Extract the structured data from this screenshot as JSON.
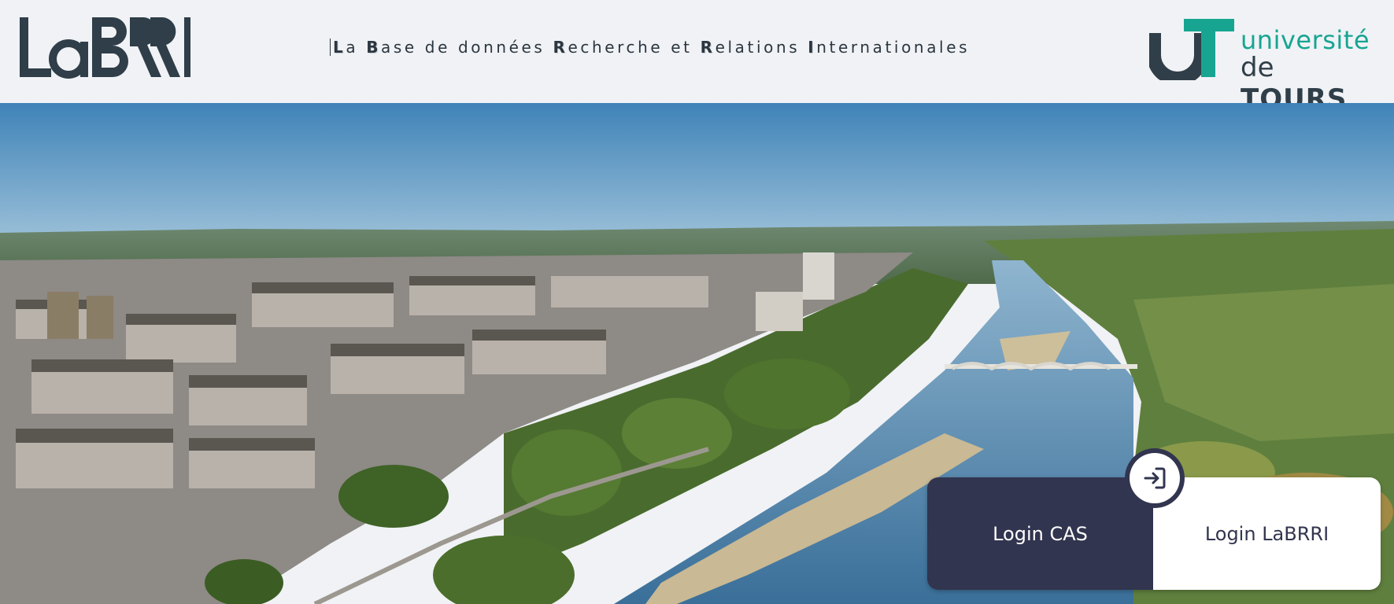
{
  "header": {
    "logo_text": "LaBRRI",
    "tagline": {
      "parts": [
        {
          "initial": "L",
          "rest": "a"
        },
        {
          "initial": "B",
          "rest": "ase de données"
        },
        {
          "initial": "R",
          "rest": "echerche et"
        },
        {
          "initial": "R",
          "rest": "elations"
        },
        {
          "initial": "I",
          "rest": "nternationales"
        }
      ]
    },
    "university_logo": {
      "line1": "université",
      "line2_prefix": "de",
      "line2_bold": "TOURS"
    }
  },
  "hero": {
    "image": "aerial-view-tours-loire-river"
  },
  "login": {
    "cas_label": "Login CAS",
    "labrri_label": "Login LaBRRI",
    "badge_icon": "login-arrow-icon"
  },
  "colors": {
    "navy": "#32354f",
    "slate": "#2f3e48",
    "teal": "#17a592",
    "header_bg": "#f0f2f5"
  }
}
